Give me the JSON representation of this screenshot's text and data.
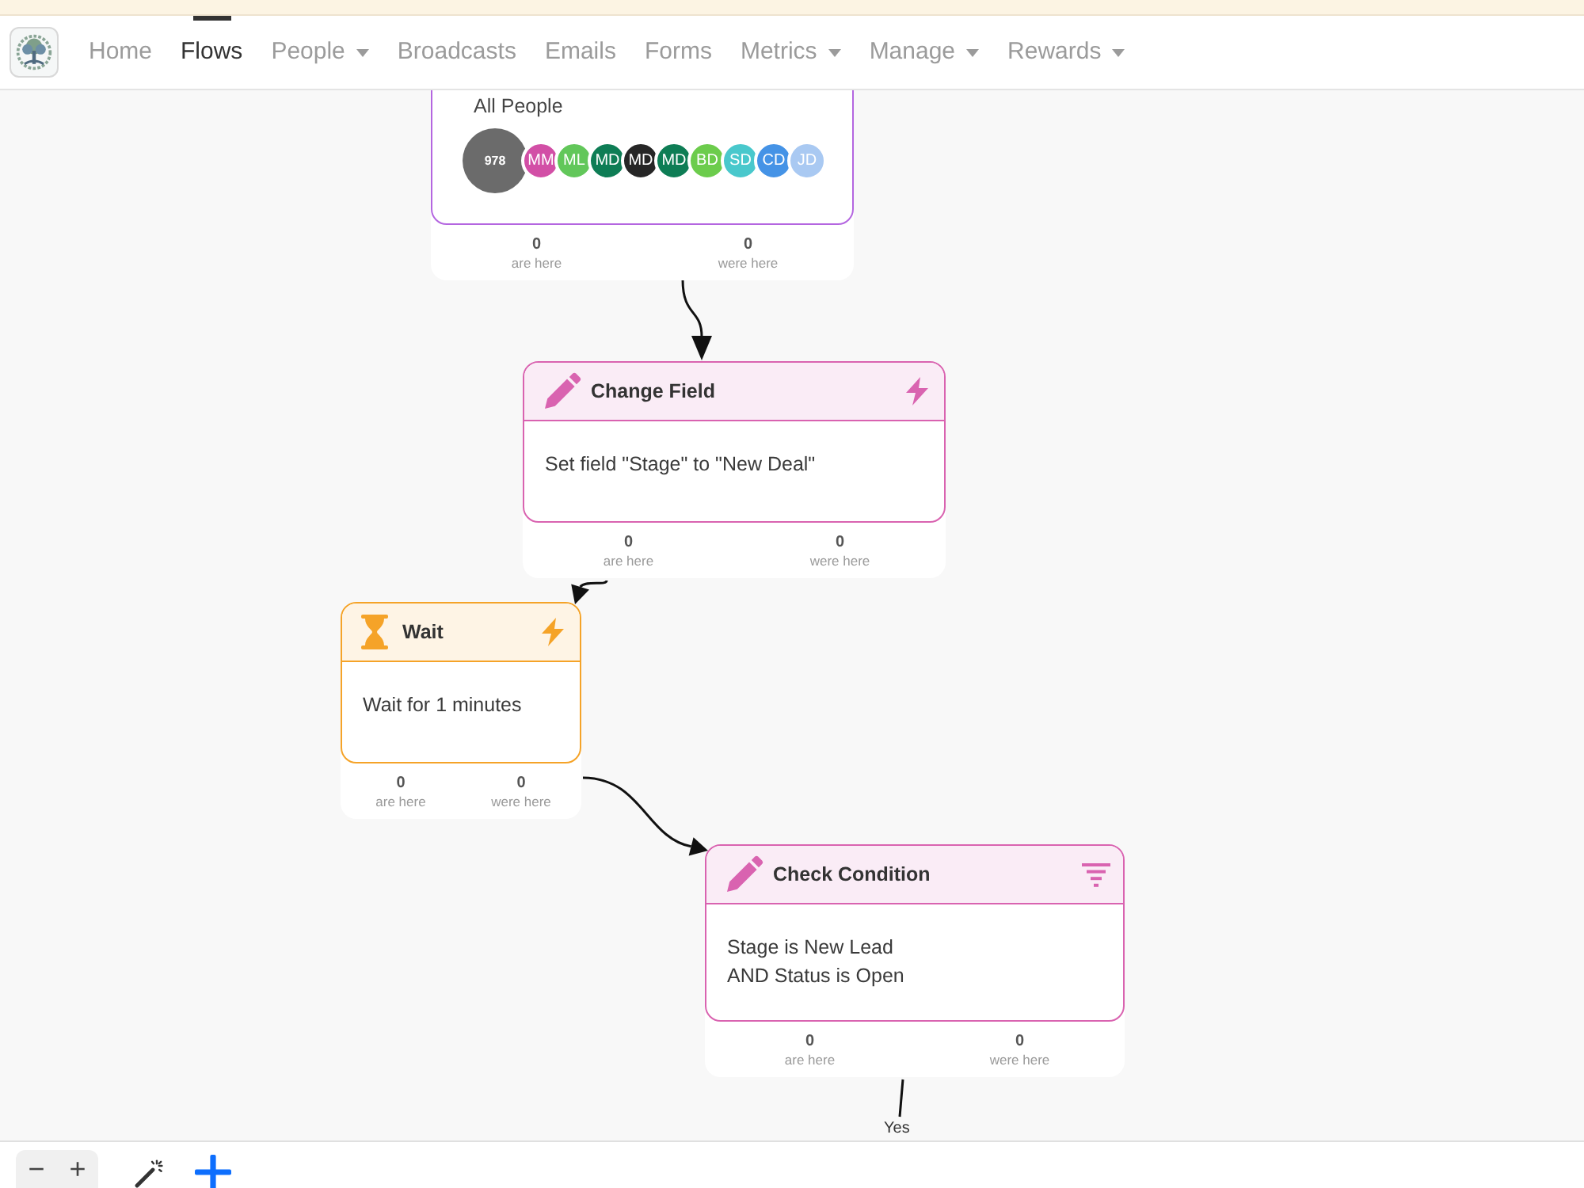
{
  "nav": {
    "items": [
      {
        "label": "Home",
        "kind": "link",
        "selected": false
      },
      {
        "label": "Flows",
        "kind": "link",
        "selected": true
      },
      {
        "label": "People",
        "kind": "menu",
        "selected": false
      },
      {
        "label": "Broadcasts",
        "kind": "link",
        "selected": false
      },
      {
        "label": "Emails",
        "kind": "link",
        "selected": false
      },
      {
        "label": "Forms",
        "kind": "link",
        "selected": false
      },
      {
        "label": "Metrics",
        "kind": "menu",
        "selected": false
      },
      {
        "label": "Manage",
        "kind": "menu",
        "selected": false
      },
      {
        "label": "Rewards",
        "kind": "menu",
        "selected": false
      }
    ]
  },
  "flow": {
    "nodes": [
      {
        "kind": "trigger",
        "color": "#b466e0",
        "audience": "All People",
        "count": "978",
        "avatars": [
          {
            "initials": "MM",
            "color": "#d24fa6"
          },
          {
            "initials": "ML",
            "color": "#62c75a"
          },
          {
            "initials": "MD",
            "color": "#0e7d55"
          },
          {
            "initials": "MD",
            "color": "#262626"
          },
          {
            "initials": "MD",
            "color": "#0e7d55"
          },
          {
            "initials": "BD",
            "color": "#6ccc4c"
          },
          {
            "initials": "SD",
            "color": "#49c8cc"
          },
          {
            "initials": "CD",
            "color": "#4593e6"
          },
          {
            "initials": "JD",
            "color": "#a9c9f2"
          }
        ],
        "stats": [
          {
            "value": "0",
            "label": "are here"
          },
          {
            "value": "0",
            "label": "were here"
          }
        ]
      },
      {
        "kind": "change_field",
        "color": "#d963b0",
        "title": "Change Field",
        "lines": [
          "Set field \"Stage\" to \"New Deal\""
        ],
        "stats": [
          {
            "value": "0",
            "label": "are here"
          },
          {
            "value": "0",
            "label": "were here"
          }
        ]
      },
      {
        "kind": "wait",
        "color": "#f5a328",
        "title": "Wait",
        "lines": [
          "Wait for 1 minutes"
        ],
        "stats": [
          {
            "value": "0",
            "label": "are here"
          },
          {
            "value": "0",
            "label": "were here"
          }
        ]
      },
      {
        "kind": "condition",
        "color": "#d963b0",
        "title": "Check Condition",
        "lines": [
          "Stage is New Lead",
          "AND Status is Open"
        ],
        "exit_label": "Yes",
        "stats": [
          {
            "value": "0",
            "label": "are here"
          },
          {
            "value": "0",
            "label": "were here"
          }
        ]
      }
    ]
  },
  "toolbar": {
    "zoom_out": "−",
    "zoom_in": "+"
  }
}
